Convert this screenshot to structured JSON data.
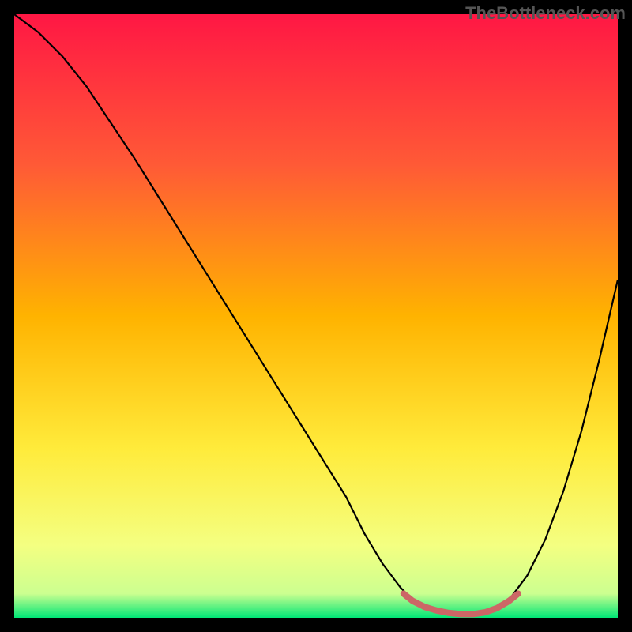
{
  "watermark": "TheBottleneck.com",
  "chart_data": {
    "type": "line",
    "title": "",
    "xlabel": "",
    "ylabel": "",
    "xlim": [
      0,
      100
    ],
    "ylim": [
      0,
      100
    ],
    "x": [
      0,
      4,
      8,
      12,
      16,
      20,
      25,
      30,
      35,
      40,
      45,
      50,
      55,
      58,
      61,
      64,
      67,
      70,
      73,
      76,
      79,
      82,
      85,
      88,
      91,
      94,
      97,
      100
    ],
    "values": [
      100,
      97,
      93,
      88,
      82,
      76,
      68,
      60,
      52,
      44,
      36,
      28,
      20,
      14,
      9,
      5,
      2,
      1,
      0.5,
      0.5,
      1,
      3,
      7,
      13,
      21,
      31,
      43,
      56
    ],
    "highlight": {
      "x": [
        64.5,
        66,
        68,
        70,
        72,
        74,
        76,
        78,
        80,
        82,
        83.5
      ],
      "values": [
        4.0,
        2.8,
        1.8,
        1.2,
        0.8,
        0.6,
        0.6,
        0.9,
        1.6,
        2.8,
        4.0
      ]
    },
    "gradient_stops": [
      {
        "offset": 0,
        "color": "#ff1744"
      },
      {
        "offset": 25,
        "color": "#ff5a36"
      },
      {
        "offset": 50,
        "color": "#ffb300"
      },
      {
        "offset": 72,
        "color": "#ffeb3b"
      },
      {
        "offset": 88,
        "color": "#f4ff81"
      },
      {
        "offset": 96,
        "color": "#ccff90"
      },
      {
        "offset": 100,
        "color": "#00e676"
      }
    ],
    "curve_color": "#000000",
    "highlight_color": "#cc6666"
  }
}
